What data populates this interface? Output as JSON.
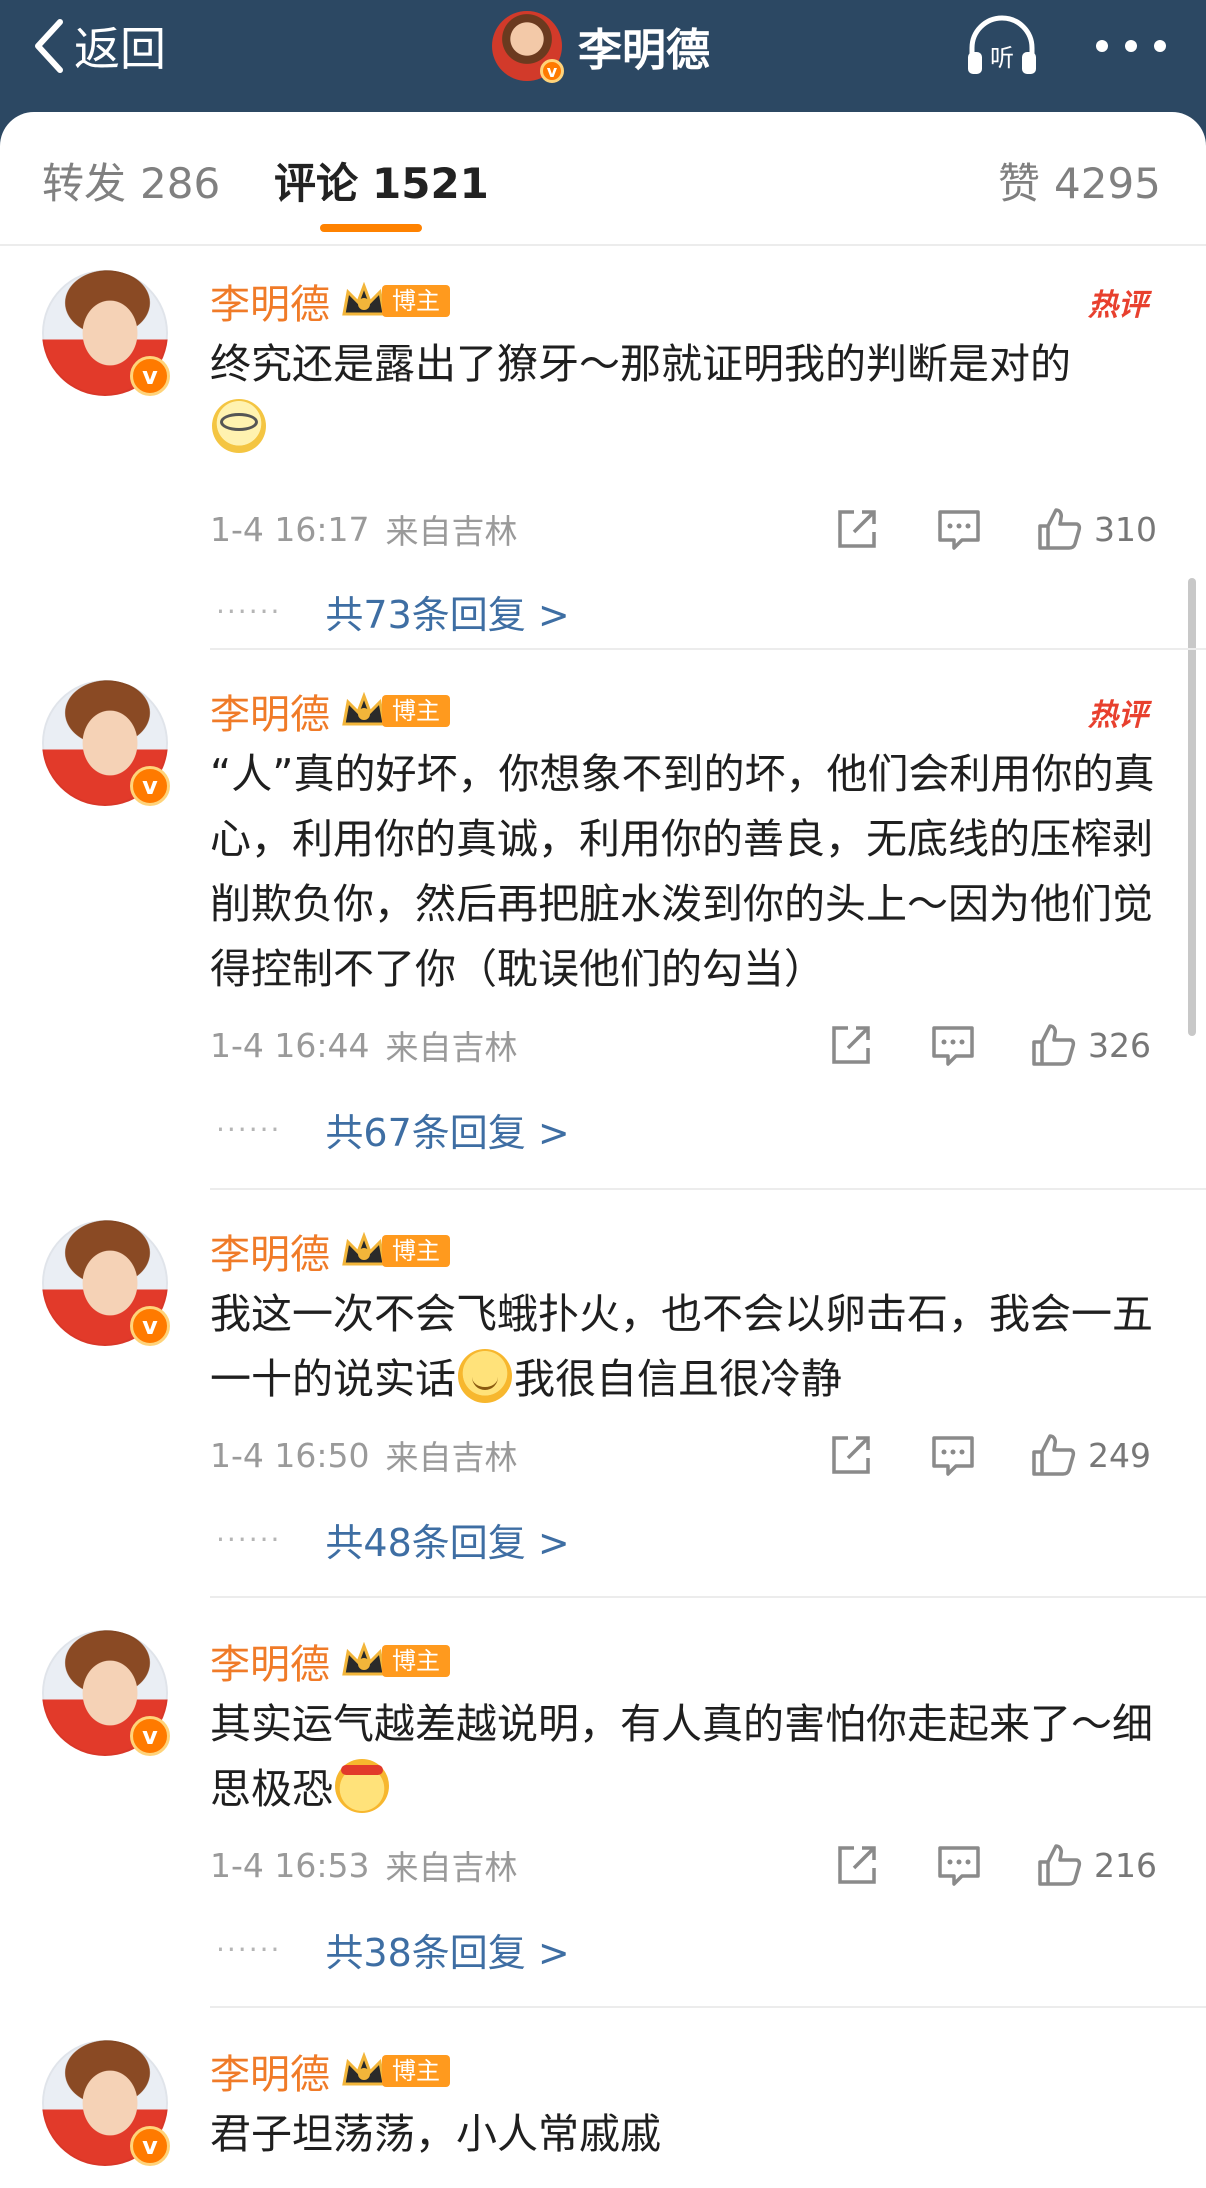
{
  "header": {
    "back_label": "返回",
    "title": "李明德",
    "listen_label": "听"
  },
  "tabs": {
    "repost_label": "转发",
    "repost_count": "286",
    "comment_label": "评论",
    "comment_count": "1521",
    "like_label": "赞",
    "like_count": "4295"
  },
  "comments": [
    {
      "author": "李明德",
      "tag": "博主",
      "hot": "热评",
      "text1": "终究还是露出了獠牙～那就证明我的判断是对的",
      "text2": "",
      "emoji": "glasses-emoji",
      "time": "1-4 16:17",
      "location": "来自吉林",
      "likes": "310",
      "replies": "共73条回复 >"
    },
    {
      "author": "李明德",
      "tag": "博主",
      "hot": "热评",
      "text1": "“人”真的好坏，你想象不到的坏，他们会利用你的真心，利用你的真诚，利用你的善良，无底线的压榨剥削欺负你，然后再把脏水泼到你的头上～因为他们觉得控制不了你（耽误他们的勾当）",
      "time": "1-4 16:44",
      "location": "来自吉林",
      "likes": "326",
      "replies": "共67条回复 >"
    },
    {
      "author": "李明德",
      "tag": "博主",
      "text1": "我这一次不会飞蛾扑火，也不会以卵击石，我会一五一十的说实话",
      "text2": "我很自信且很冷静",
      "emoji": "smile-emoji",
      "time": "1-4 16:50",
      "location": "来自吉林",
      "likes": "249",
      "replies": "共48条回复 >"
    },
    {
      "author": "李明德",
      "tag": "博主",
      "text1": "其实运气越差越说明，有人真的害怕你走起来了～细思极恐",
      "emoji": "fighting-emoji",
      "time": "1-4 16:53",
      "location": "来自吉林",
      "likes": "216",
      "replies": "共38条回复 >"
    },
    {
      "author": "李明德",
      "tag": "博主",
      "text1": "君子坦荡荡，小人常戚戚"
    }
  ],
  "colors": {
    "header_bg": "#2c4863",
    "username": "#f07b28",
    "accent": "#ff8200",
    "reply_link": "#3e6ea3",
    "hot": "#e8402e"
  }
}
